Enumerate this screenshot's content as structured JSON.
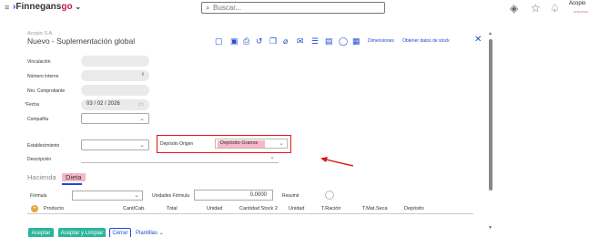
{
  "topbar": {
    "brand_prefix": "›",
    "brand_name": "Finnegans",
    "brand_suffix": "go",
    "brand_caret": "⌄",
    "search_placeholder": "Buscar...",
    "user_name": "Acopio",
    "user_company": "empresa"
  },
  "form": {
    "company": "Acopio S.A.",
    "title": "Nuevo - Suplementación global",
    "toolbar_links": {
      "dimensiones": "Dimensiones",
      "obtener_stock": "Obtener datos de stock"
    },
    "labels": {
      "vinculacion": "Vinculación",
      "numero_interno": "Número interno",
      "nro_comprobante": "Nro. Comprobante",
      "fecha": "Fecha",
      "compania": "Compañía",
      "establecimiento": "Establecimiento",
      "deposito_origen": "Depósito Origen",
      "descripcion": "Descripción"
    },
    "required_mark": "*",
    "fecha_value": "03 / 02 / 2026",
    "deposito_origen_value": "Depósito Granos"
  },
  "tabs": {
    "hacienda": "Hacienda",
    "dieta": "Dieta"
  },
  "dieta": {
    "formula_label": "Fórmula",
    "unidades_label": "Unidades Fórmula",
    "unidades_value": "0.0000",
    "resumir_label": "Resumir",
    "columns": [
      "Producto",
      "Cant/Cab.",
      "Total",
      "Unidad",
      "Cantidad Stock 2",
      "Unidad",
      "T.Ración",
      "T.Mat.Seca",
      "Depósito"
    ]
  },
  "buttons": {
    "aceptar": "Aceptar",
    "aceptar_limpiar": "Aceptar y Limpiar",
    "cerrar": "Cerrar",
    "plantillas": "Plantillas"
  },
  "colors": {
    "accent": "#1e4bd2",
    "highlight": "#f7b7c6",
    "primary_button": "#2ab59b",
    "annotation_red": "#e11111"
  }
}
